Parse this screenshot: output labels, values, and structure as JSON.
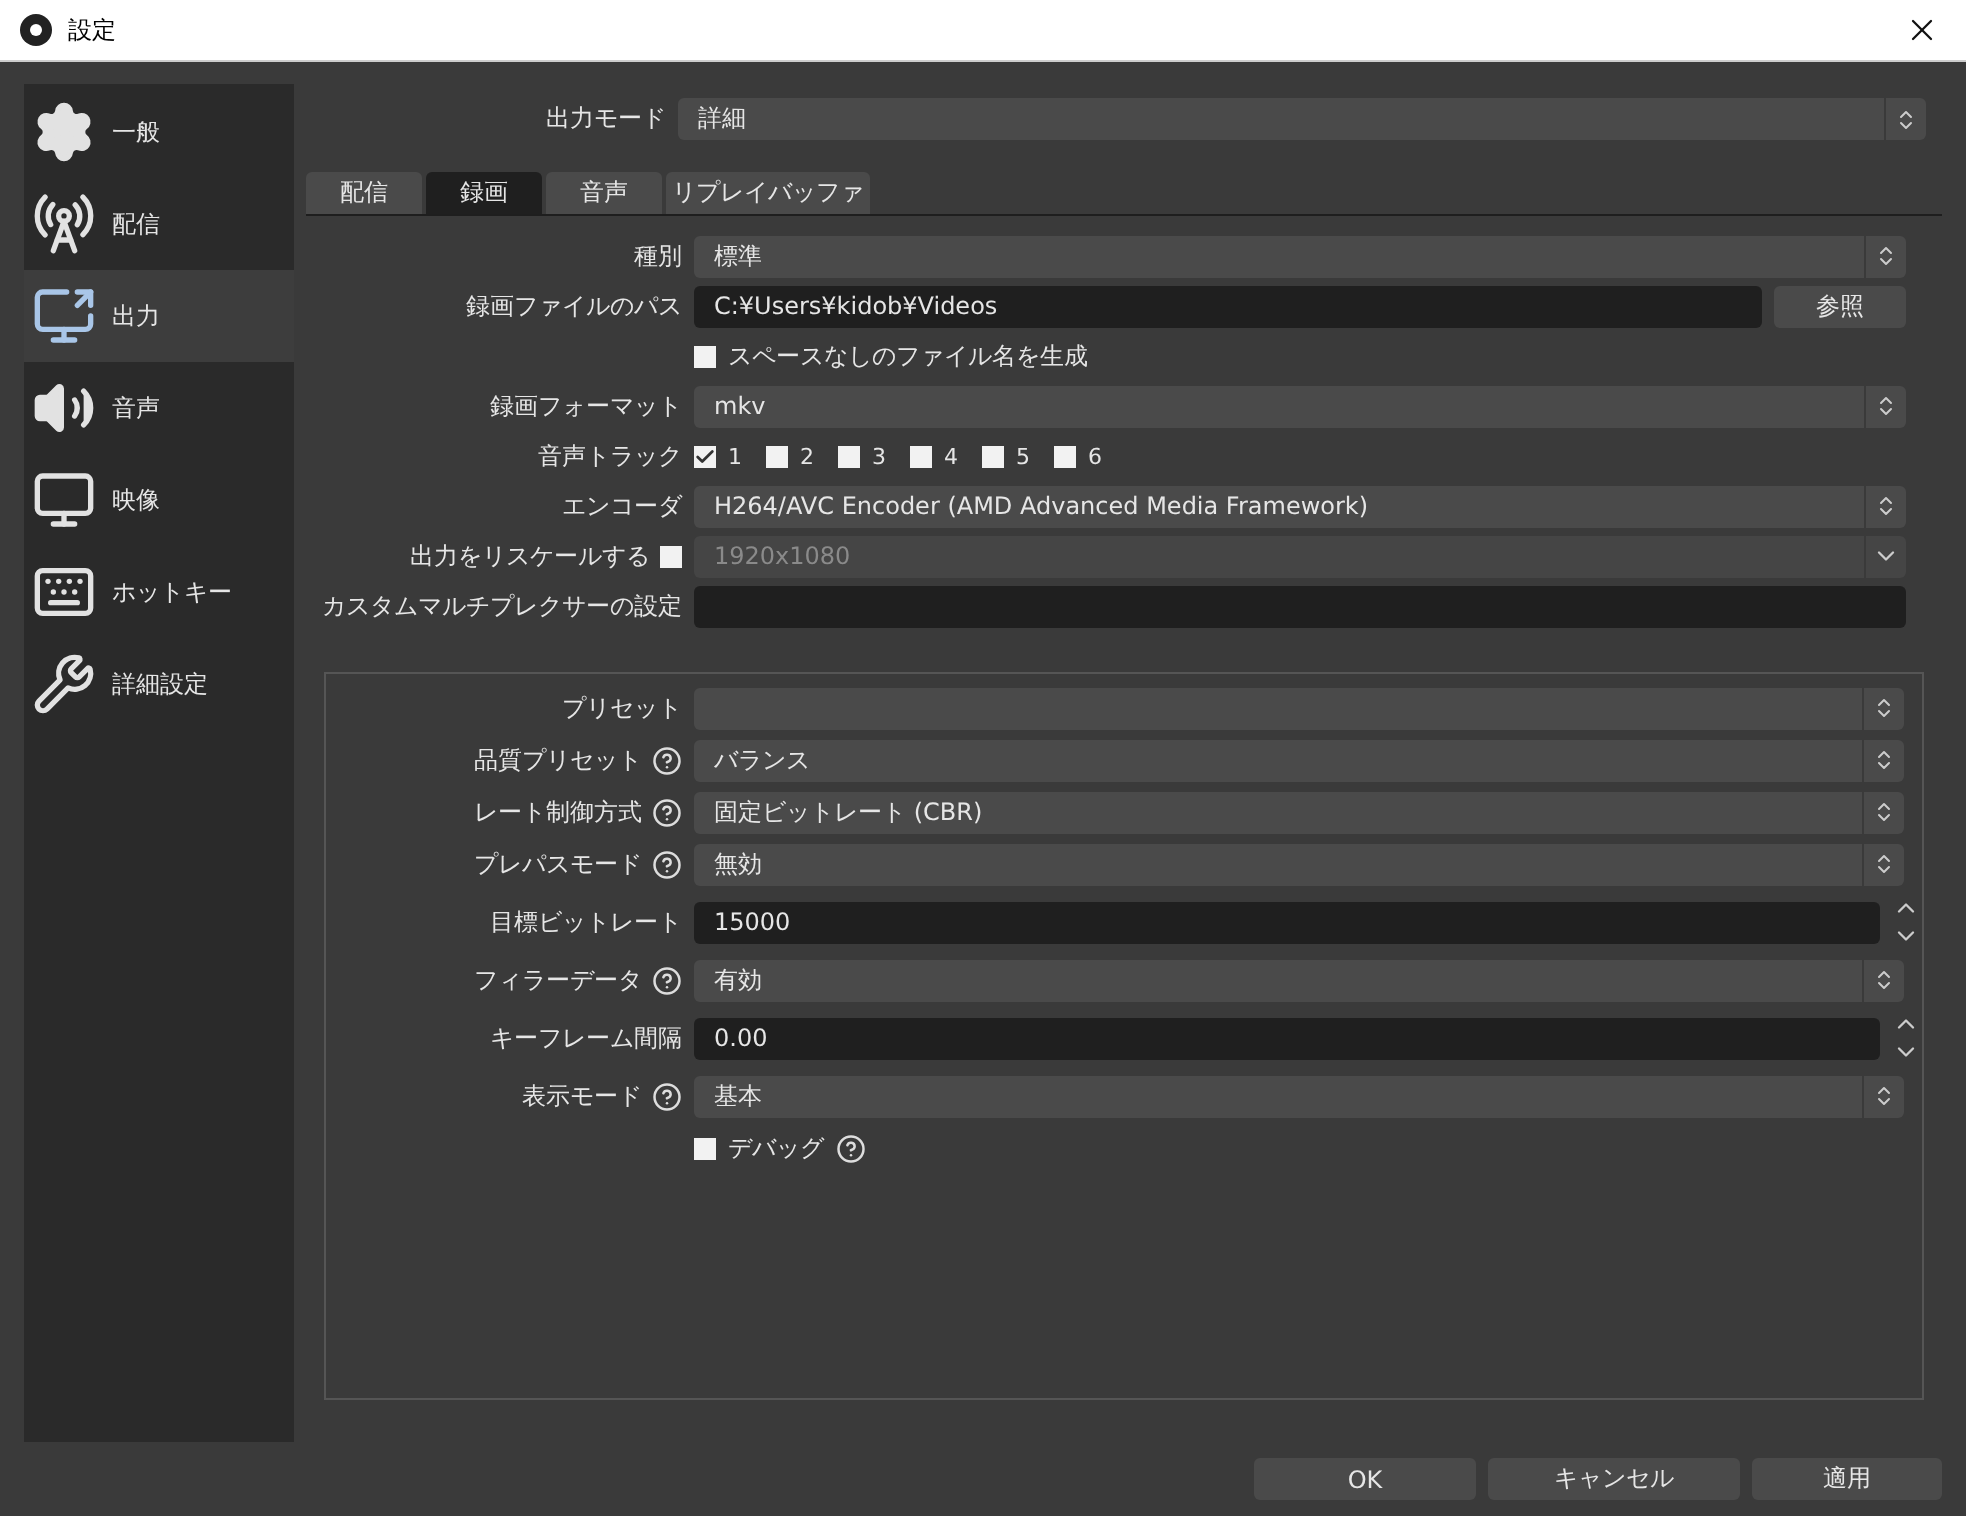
{
  "window": {
    "title": "設定"
  },
  "sidebar": {
    "items": [
      {
        "label": "一般",
        "selected": false
      },
      {
        "label": "配信",
        "selected": false
      },
      {
        "label": "出力",
        "selected": true
      },
      {
        "label": "音声",
        "selected": false
      },
      {
        "label": "映像",
        "selected": false
      },
      {
        "label": "ホットキー",
        "selected": false
      },
      {
        "label": "詳細設定",
        "selected": false
      }
    ]
  },
  "output_mode": {
    "label": "出力モード",
    "value": "詳細"
  },
  "tabs": [
    {
      "label": "配信",
      "selected": false
    },
    {
      "label": "録画",
      "selected": true
    },
    {
      "label": "音声",
      "selected": false
    },
    {
      "label": "リプレイバッファ",
      "selected": false
    }
  ],
  "recording": {
    "rows": [
      {
        "kind": "select",
        "label": "種別",
        "value": "標準"
      },
      {
        "kind": "path",
        "label": "録画ファイルのパス",
        "value": "C:¥Users¥kidob¥Videos",
        "button": "参照"
      },
      {
        "kind": "checkbox",
        "label": "スペースなしのファイル名を生成",
        "checked": false
      },
      {
        "kind": "select",
        "label": "録画フォーマット",
        "value": "mkv"
      },
      {
        "kind": "tracks",
        "label": "音声トラック",
        "tracks": [
          {
            "label": "1",
            "checked": true
          },
          {
            "label": "2",
            "checked": false
          },
          {
            "label": "3",
            "checked": false
          },
          {
            "label": "4",
            "checked": false
          },
          {
            "label": "5",
            "checked": false
          },
          {
            "label": "6",
            "checked": false
          }
        ]
      },
      {
        "kind": "select",
        "label": "エンコーダ",
        "value": "H264/AVC Encoder (AMD Advanced Media Framework)"
      },
      {
        "kind": "rescale",
        "label": "出力をリスケールする",
        "checked": false,
        "value": "1920x1080",
        "disabled": true
      },
      {
        "kind": "text",
        "label": "カスタムマルチプレクサーの設定"
      }
    ]
  },
  "encoder": {
    "rows": [
      {
        "kind": "select",
        "label": "プリセット",
        "help": false
      },
      {
        "kind": "select",
        "label": "品質プリセット",
        "help": true,
        "value": "バランス"
      },
      {
        "kind": "select",
        "label": "レート制御方式",
        "help": true,
        "value": "固定ビットレート (CBR)"
      },
      {
        "kind": "select",
        "label": "プレパスモード",
        "help": true,
        "value": "無効"
      },
      {
        "kind": "spin",
        "label": "目標ビットレート",
        "help": false,
        "value": "15000"
      },
      {
        "kind": "select",
        "label": "フィラーデータ",
        "help": true,
        "value": "有効"
      },
      {
        "kind": "spin",
        "label": "キーフレーム間隔",
        "help": false,
        "value": "0.00"
      },
      {
        "kind": "select",
        "label": "表示モード",
        "help": true,
        "value": "基本"
      },
      {
        "kind": "checkbox",
        "label": "デバッグ",
        "help": true,
        "checked": false
      }
    ]
  },
  "buttons": [
    "OK",
    "キャンセル",
    "適用"
  ]
}
